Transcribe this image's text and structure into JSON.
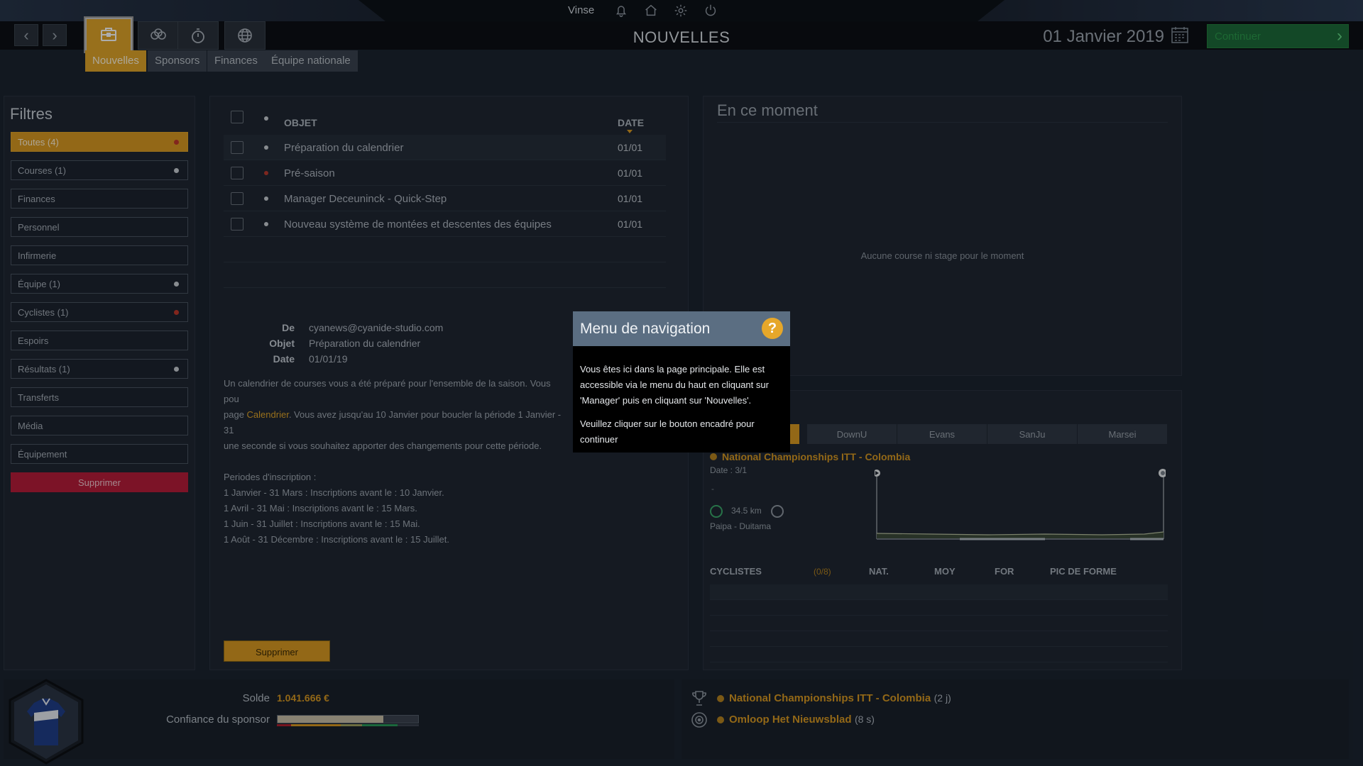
{
  "header": {
    "username": "Vinse",
    "page_title": "NOUVELLES",
    "date": "01 Janvier 2019",
    "continue_label": "Continuer",
    "top_icons": [
      "bell-icon",
      "home-icon",
      "gear-icon",
      "power-icon"
    ],
    "module_icons": [
      "briefcase-icon",
      "cyclists-icon",
      "stopwatch-icon",
      "globe-icon"
    ]
  },
  "subtabs": [
    "Nouvelles",
    "Sponsors",
    "Finances",
    "Équipe nationale"
  ],
  "filters": {
    "title": "Filtres",
    "items": [
      {
        "label": "Toutes (4)",
        "dot": "red"
      },
      {
        "label": "Courses (1)",
        "dot": "white"
      },
      {
        "label": "Finances",
        "dot": ""
      },
      {
        "label": "Personnel",
        "dot": ""
      },
      {
        "label": "Infirmerie",
        "dot": ""
      },
      {
        "label": "Équipe (1)",
        "dot": "white"
      },
      {
        "label": "Cyclistes (1)",
        "dot": "red"
      },
      {
        "label": "Espoirs",
        "dot": ""
      },
      {
        "label": "Résultats (1)",
        "dot": "white"
      },
      {
        "label": "Transferts",
        "dot": ""
      },
      {
        "label": "Média",
        "dot": ""
      },
      {
        "label": "Équipement",
        "dot": ""
      }
    ],
    "delete_label": "Supprimer"
  },
  "news": {
    "col_subject": "OBJET",
    "col_date": "DATE",
    "rows": [
      {
        "subject": "Préparation du calendrier",
        "date": "01/01",
        "unread": "white"
      },
      {
        "subject": "Pré-saison",
        "date": "01/01",
        "unread": "red"
      },
      {
        "subject": "Manager Deceuninck - Quick-Step",
        "date": "01/01",
        "unread": "white"
      },
      {
        "subject": "Nouveau système de montées et descentes des équipes",
        "date": "01/01",
        "unread": "white"
      }
    ],
    "detail": {
      "from_label": "De",
      "from_value": "cyanews@cyanide-studio.com",
      "subject_label": "Objet",
      "subject_value": "Préparation du calendrier",
      "date_label": "Date",
      "date_value": "01/01/19",
      "body_1": "Un calendrier de courses vous a été préparé pour l'ensemble de la saison. Vous pou",
      "body_2a": "page ",
      "body_link": "Calendrier",
      "body_2b": ". Vous avez jusqu'au 10 Janvier pour boucler la période 1 Janvier - 31",
      "body_3": "une seconde si vous souhaitez apporter des changements pour cette période.",
      "periods_title": "Periodes d'inscription :",
      "periods": [
        "1 Janvier - 31 Mars : Inscriptions avant le : 10 Janvier.",
        "1 Avril - 31 Mai : Inscriptions avant le : 15 Mars.",
        "1 Juin - 31 Juillet : Inscriptions avant le : 15 Mai.",
        "1 Août - 31 Décembre : Inscriptions avant le : 15 Juillet."
      ]
    },
    "delete_label": "Supprimer"
  },
  "now": {
    "title": "En ce moment",
    "empty": "Aucune course ni stage pour le moment"
  },
  "upcoming": {
    "title_visible": "ment",
    "tabs": [
      "",
      "DownU",
      "Evans",
      "SanJu",
      "Marsei"
    ],
    "race_name": "National Championships ITT - Colombia",
    "race_date": "Date : 3/1",
    "race_dash": "-",
    "distance": "34.5 km",
    "route": "Paipa - Duitama",
    "headers": {
      "cyclists": "CYCLISTES",
      "count": "(0/8)",
      "nat": "NAT.",
      "moy": "MOY",
      "for": "FOR",
      "peak": "PIC DE FORME"
    }
  },
  "bottom": {
    "solde_label": "Solde",
    "solde_value": "1.041.666 €",
    "confidence_label": "Confiance du sponsor",
    "confidence_level": 0.75,
    "events": [
      {
        "icon": "trophy-icon",
        "name": "National Championships ITT - Colombia",
        "days": "(2 j)"
      },
      {
        "icon": "target-icon",
        "name": "Omloop Het Nieuwsblad",
        "days": "(8 s)"
      }
    ]
  },
  "dialog": {
    "title": "Menu de navigation",
    "help": "?",
    "p1": "Vous êtes ici dans la page principale. Elle est accessible via le menu du haut en cliquant sur 'Manager' puis en cliquant sur 'Nouvelles'.",
    "p2": "Veuillez cliquer sur le bouton encadré pour continuer"
  }
}
